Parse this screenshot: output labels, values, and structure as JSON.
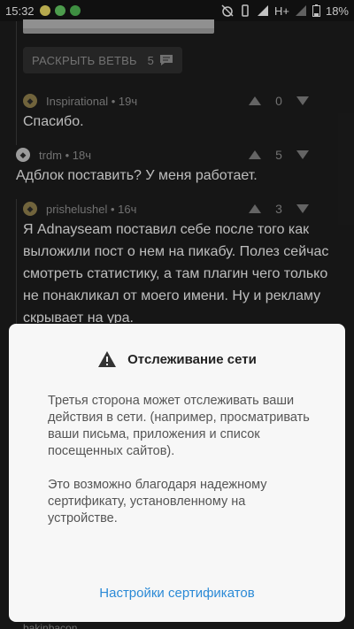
{
  "status_bar": {
    "time": "15:32",
    "network": "H+",
    "battery": "18%"
  },
  "thread": {
    "expand_button": {
      "label": "РАСКРЫТЬ ВЕТВЬ",
      "count": "5"
    },
    "comments": [
      {
        "author": "Inspirational",
        "age": "19ч",
        "score": "0",
        "text": "Спасибо."
      },
      {
        "author": "trdm",
        "age": "18ч",
        "score": "5",
        "text": "Адблок поставить? У меня работает."
      },
      {
        "author": "prishelushel",
        "age": "16ч",
        "score": "3",
        "text": "Я Adnayseam поставил себе после того как выложили пост о нем на пикабу. Полез сейчас смотреть статистику, а там плагин чего только не понакликал от моего имени. Ну и рекламу скрывает на ура."
      }
    ],
    "next_author_partial": "bakinbacon"
  },
  "dialog": {
    "title": "Отслеживание сети",
    "paragraph1": "Третья сторона может отслеживать ваши действия в сети. (например, просматривать ваши письма, приложения и список посещенных сайтов).",
    "paragraph2": "Это возможно благодаря надежному сертификату, установленному на устройстве.",
    "action": "Настройки сертификатов"
  },
  "colors": {
    "background": "#1c1c1c",
    "dialog_bg": "#f7f7f7",
    "link": "#2b8ad6"
  }
}
